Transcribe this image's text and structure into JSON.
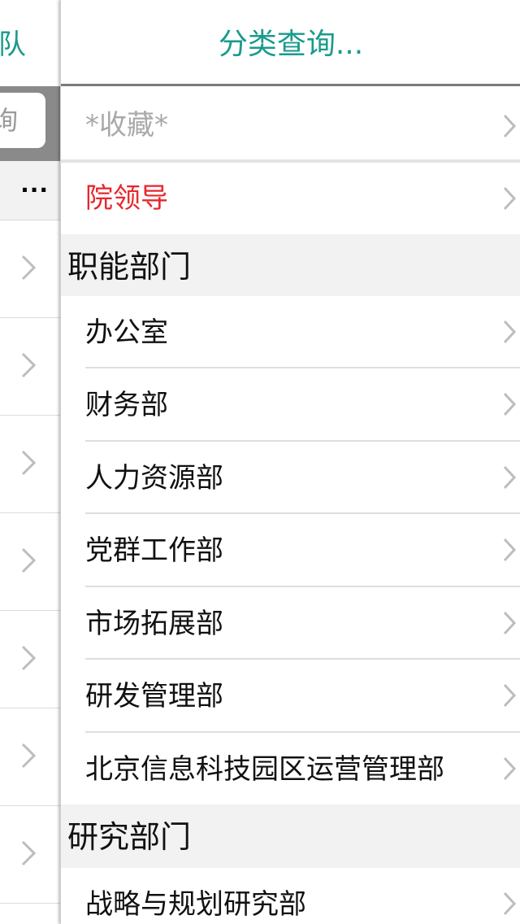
{
  "left_panel": {
    "title": "队",
    "search_placeholder": "询",
    "more": "...",
    "row_count": 7
  },
  "nav": {
    "title": "分类查询..."
  },
  "favorites": {
    "label": "*收藏*"
  },
  "leadership": {
    "label": "院领导"
  },
  "sections": [
    {
      "title": "职能部门",
      "items": [
        "办公室",
        "财务部",
        "人力资源部",
        "党群工作部",
        "市场拓展部",
        "研发管理部",
        "北京信息科技园区运营管理部"
      ]
    },
    {
      "title": "研究部门",
      "items": [
        "战略与规划研究部"
      ]
    }
  ],
  "colors": {
    "accent": "#1a9a8c",
    "leadership_text": "#e8262d",
    "favorites_text": "#a9a9a9",
    "chevron": "#bdbdbd",
    "section_bg": "#f2f2f2"
  }
}
